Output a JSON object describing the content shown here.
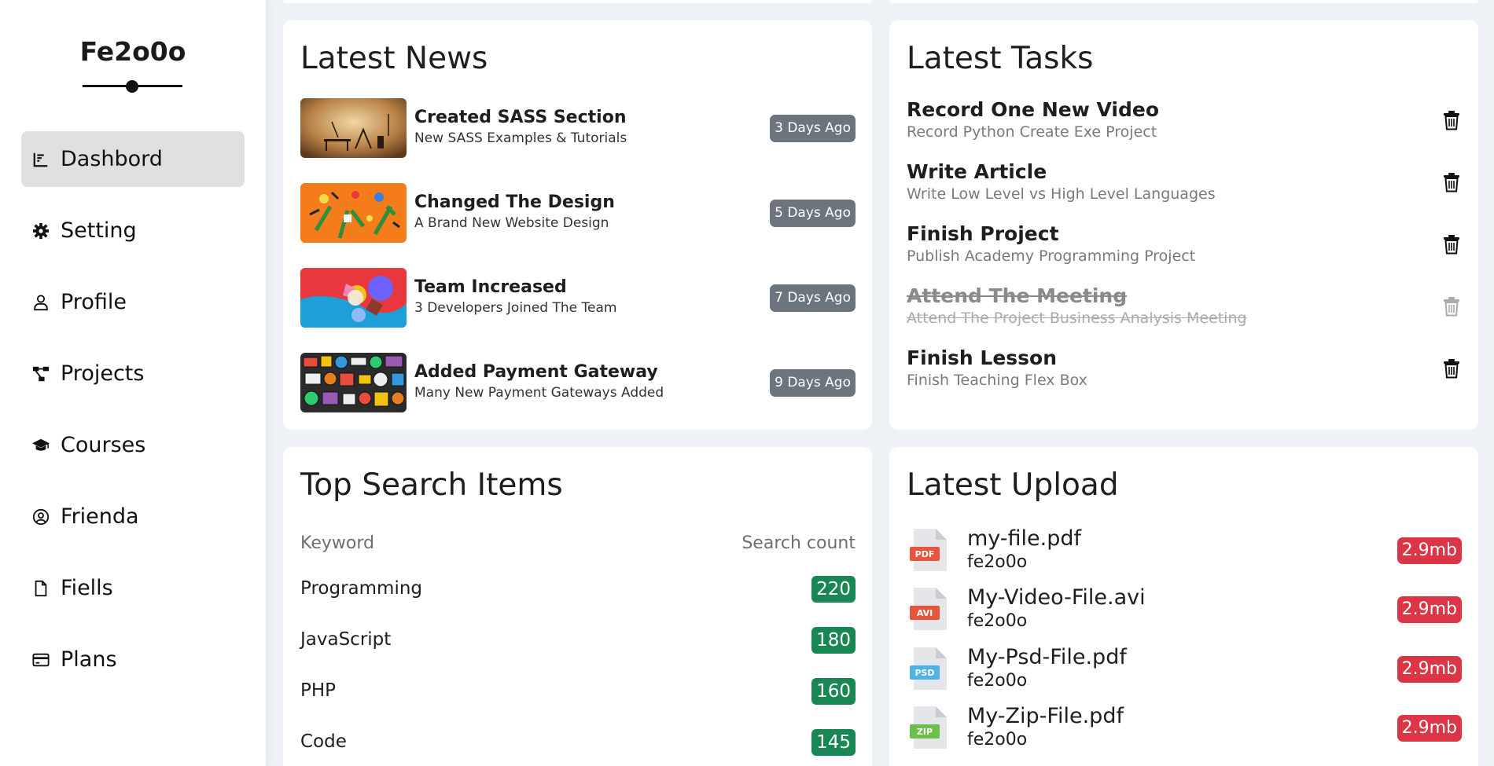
{
  "brand": {
    "logo_text": "Fe2o0o"
  },
  "sidebar": {
    "items": [
      {
        "label": "Dashbord",
        "icon": "chart-line-icon",
        "active": true
      },
      {
        "label": "Setting",
        "icon": "gear-icon"
      },
      {
        "label": "Profile",
        "icon": "user-icon"
      },
      {
        "label": "Projects",
        "icon": "diagram-project-icon"
      },
      {
        "label": "Courses",
        "icon": "graduation-cap-icon"
      },
      {
        "label": "Frienda",
        "icon": "user-circle-icon"
      },
      {
        "label": "Fiells",
        "icon": "file-icon"
      },
      {
        "label": "Plans",
        "icon": "credit-card-icon"
      }
    ]
  },
  "news": {
    "title": "Latest News",
    "items": [
      {
        "title": "Created SASS Section",
        "subtitle": "New SASS Examples & Tutorials",
        "time": "3 Days Ago"
      },
      {
        "title": "Changed The Design",
        "subtitle": "A Brand New Website Design",
        "time": "5 Days Ago"
      },
      {
        "title": "Team Increased",
        "subtitle": "3 Developers Joined The Team",
        "time": "7 Days Ago"
      },
      {
        "title": "Added Payment Gateway",
        "subtitle": "Many New Payment Gateways Added",
        "time": "9 Days Ago"
      }
    ]
  },
  "tasks": {
    "title": "Latest Tasks",
    "items": [
      {
        "title": "Record One New Video",
        "subtitle": "Record Python Create Exe Project",
        "done": false
      },
      {
        "title": "Write Article",
        "subtitle": "Write Low Level vs High Level Languages",
        "done": false
      },
      {
        "title": "Finish Project",
        "subtitle": "Publish Academy Programming Project",
        "done": false
      },
      {
        "title": "Attend The Meeting",
        "subtitle": "Attend The Project Business Analysis Meeting",
        "done": true
      },
      {
        "title": "Finish Lesson",
        "subtitle": "Finish Teaching Flex Box",
        "done": false
      }
    ]
  },
  "search": {
    "title": "Top Search Items",
    "col_keyword": "Keyword",
    "col_count": "Search count",
    "rows": [
      {
        "keyword": "Programming",
        "count": "220"
      },
      {
        "keyword": "JavaScript",
        "count": "180"
      },
      {
        "keyword": "PHP",
        "count": "160"
      },
      {
        "keyword": "Code",
        "count": "145"
      }
    ]
  },
  "uploads": {
    "title": "Latest Upload",
    "items": [
      {
        "name": "my-file.pdf",
        "owner": "fe2o0o",
        "size": "2.9mb",
        "type": "PDF",
        "color": "#e8553e"
      },
      {
        "name": "My-Video-File.avi",
        "owner": "fe2o0o",
        "size": "2.9mb",
        "type": "AVI",
        "color": "#e8553e"
      },
      {
        "name": "My-Psd-File.pdf",
        "owner": "fe2o0o",
        "size": "2.9mb",
        "type": "PSD",
        "color": "#4fb3e8"
      },
      {
        "name": "My-Zip-File.pdf",
        "owner": "fe2o0o",
        "size": "2.9mb",
        "type": "ZIP",
        "color": "#6cbf4a"
      }
    ]
  },
  "colors": {
    "news_badge": "#6c757d",
    "search_badge": "#198754",
    "size_badge": "#dc3545",
    "active_nav": "#e0e0e0"
  }
}
